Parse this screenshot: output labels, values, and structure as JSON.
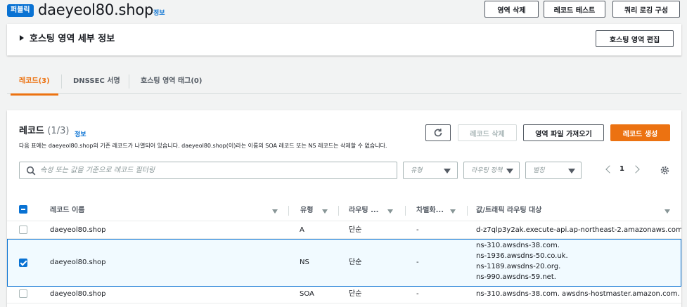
{
  "header": {
    "badge": "퍼블릭",
    "title": "daeyeol80.shop",
    "info": "정보",
    "buttons": {
      "delete_zone": "영역 삭제",
      "test_record": "레코드 테스트",
      "query_logging": "쿼리 로깅 구성"
    }
  },
  "details": {
    "title": "호스팅 영역 세부 정보",
    "edit_button": "호스팅 영역 편집"
  },
  "tabs": [
    {
      "label": "레코드(3)",
      "active": true
    },
    {
      "label": "DNSSEC 서명",
      "active": false
    },
    {
      "label": "호스팅 영역 태그(0)",
      "active": false
    }
  ],
  "records": {
    "title": "레코드",
    "count": "(1/3)",
    "info": "정보",
    "description": "다음 표에는 daeyeol80.shop의 기존 레코드가 나열되어 있습니다. daeyeol80.shop(이)라는 이름의 SOA 레코드 또는 NS 레코드는 삭제할 수 없습니다.",
    "buttons": {
      "delete": "레코드 삭제",
      "import": "영역 파일 가져오기",
      "create": "레코드 생성"
    },
    "search_placeholder": "속성 또는 값을 기준으로 레코드 필터링",
    "filters": {
      "type": "유형",
      "routing": "라우팅 정책",
      "alias": "별칭"
    },
    "page": "1",
    "columns": [
      "레코드 이름",
      "유형",
      "라우팅 ...",
      "차별화...",
      "값/트래픽 라우팅 대상"
    ],
    "rows": [
      {
        "name": "daeyeol80.shop",
        "type": "A",
        "routing": "단순",
        "diff": "-",
        "value": [
          "d-z7qlp3y2ak.execute-api.ap-northeast-2.amazonaws.com"
        ],
        "checked": false
      },
      {
        "name": "daeyeol80.shop",
        "type": "NS",
        "routing": "단순",
        "diff": "-",
        "value": [
          "ns-310.awsdns-38.com.",
          "ns-1936.awsdns-50.co.uk.",
          "ns-1189.awsdns-20.org.",
          "ns-990.awsdns-59.net."
        ],
        "checked": true
      },
      {
        "name": "daeyeol80.shop",
        "type": "SOA",
        "routing": "단순",
        "diff": "-",
        "value": [
          "ns-310.awsdns-38.com. awsdns-hostmaster.amazon.com."
        ],
        "checked": false
      }
    ]
  },
  "colors": {
    "accent": "#ec7211",
    "link": "#0972d3",
    "selected_bg": "#f1faff"
  }
}
